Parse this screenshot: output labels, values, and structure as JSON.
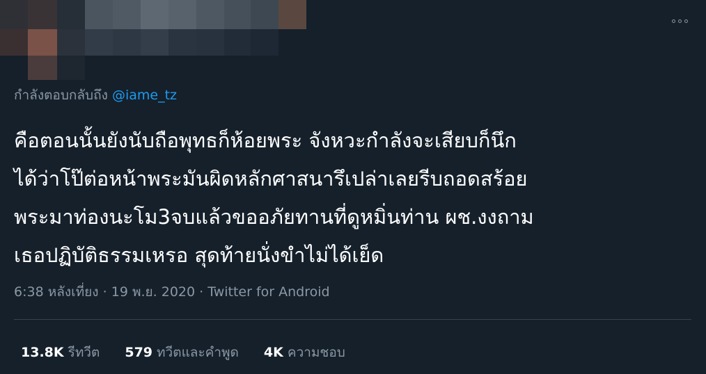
{
  "header": {
    "more_icon": "more-horizontal-icon"
  },
  "reply": {
    "prefix": "กำลังตอบกลับถึง",
    "mention": "@iame_tz"
  },
  "tweet": {
    "lines": [
      "คือตอนนั้นยังนับถือพุทธก็ห้อยพระ จังหวะกำลังจะเสียบก็นึก",
      "ได้ว่าโป๊ต่อหน้าพระมันผิดหลักศาสนารึเปล่าเลยรีบถอดสร้อย",
      "พระมาท่องนะโม3จบแล้วขออภัยทานที่ดูหมิ่นท่าน ผช.งงถาม",
      "เธอปฏิบัติธรรมเหรอ สุดท้ายนั่งขำไม่ได้เย็ด"
    ]
  },
  "meta": {
    "time": "6:38 หลังเที่ยง",
    "separator": "·",
    "date": "19 พ.ย. 2020",
    "source": "Twitter for Android"
  },
  "stats": {
    "retweets_count": "13.8K",
    "retweets_label": "รีทวีต",
    "quotes_count": "579",
    "quotes_label": "ทวีตและคำพูด",
    "likes_count": "4K",
    "likes_label": "ความชอบ"
  },
  "colors": {
    "background": "#15202b",
    "text_primary": "#ffffff",
    "text_secondary": "#8b98a5",
    "accent": "#1d9bf0",
    "divider": "#38444d"
  }
}
